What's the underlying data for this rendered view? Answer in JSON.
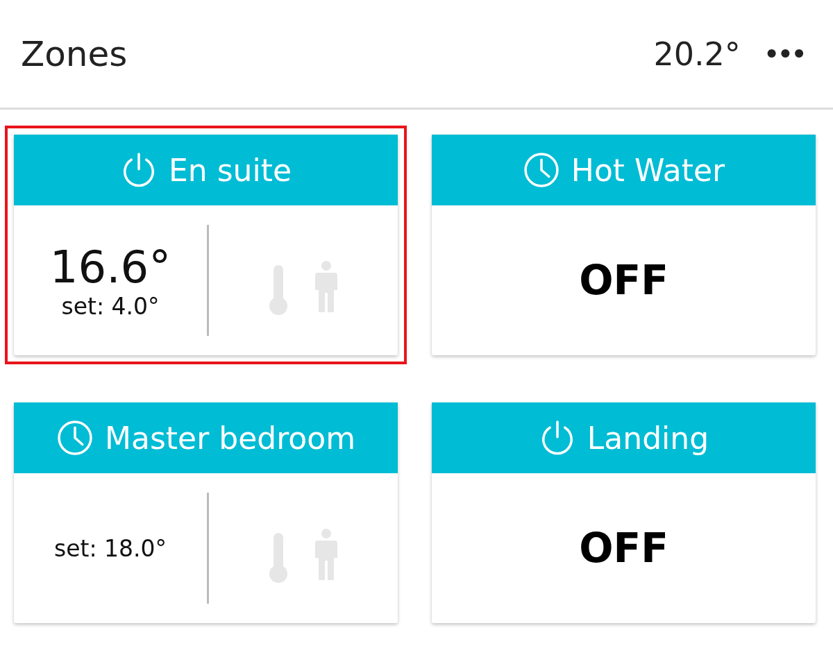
{
  "header": {
    "title": "Zones",
    "temperature": "20.2°",
    "menu": "•••"
  },
  "zones": [
    {
      "name": "En suite",
      "icon": {
        "kind": "power"
      },
      "kind": "thermostat",
      "selected": true,
      "current": "16.6°",
      "setpoint": "set: 4.0°"
    },
    {
      "name": "Hot Water",
      "icon": {
        "kind": "clock"
      },
      "kind": "switch",
      "selected": false,
      "status": "OFF"
    },
    {
      "name": "Master bedroom",
      "icon": {
        "kind": "clock"
      },
      "kind": "thermostat",
      "selected": false,
      "setpoint": "set: 18.0°"
    },
    {
      "name": "Landing",
      "icon": {
        "kind": "power"
      },
      "kind": "switch",
      "selected": false,
      "status": "OFF"
    }
  ]
}
